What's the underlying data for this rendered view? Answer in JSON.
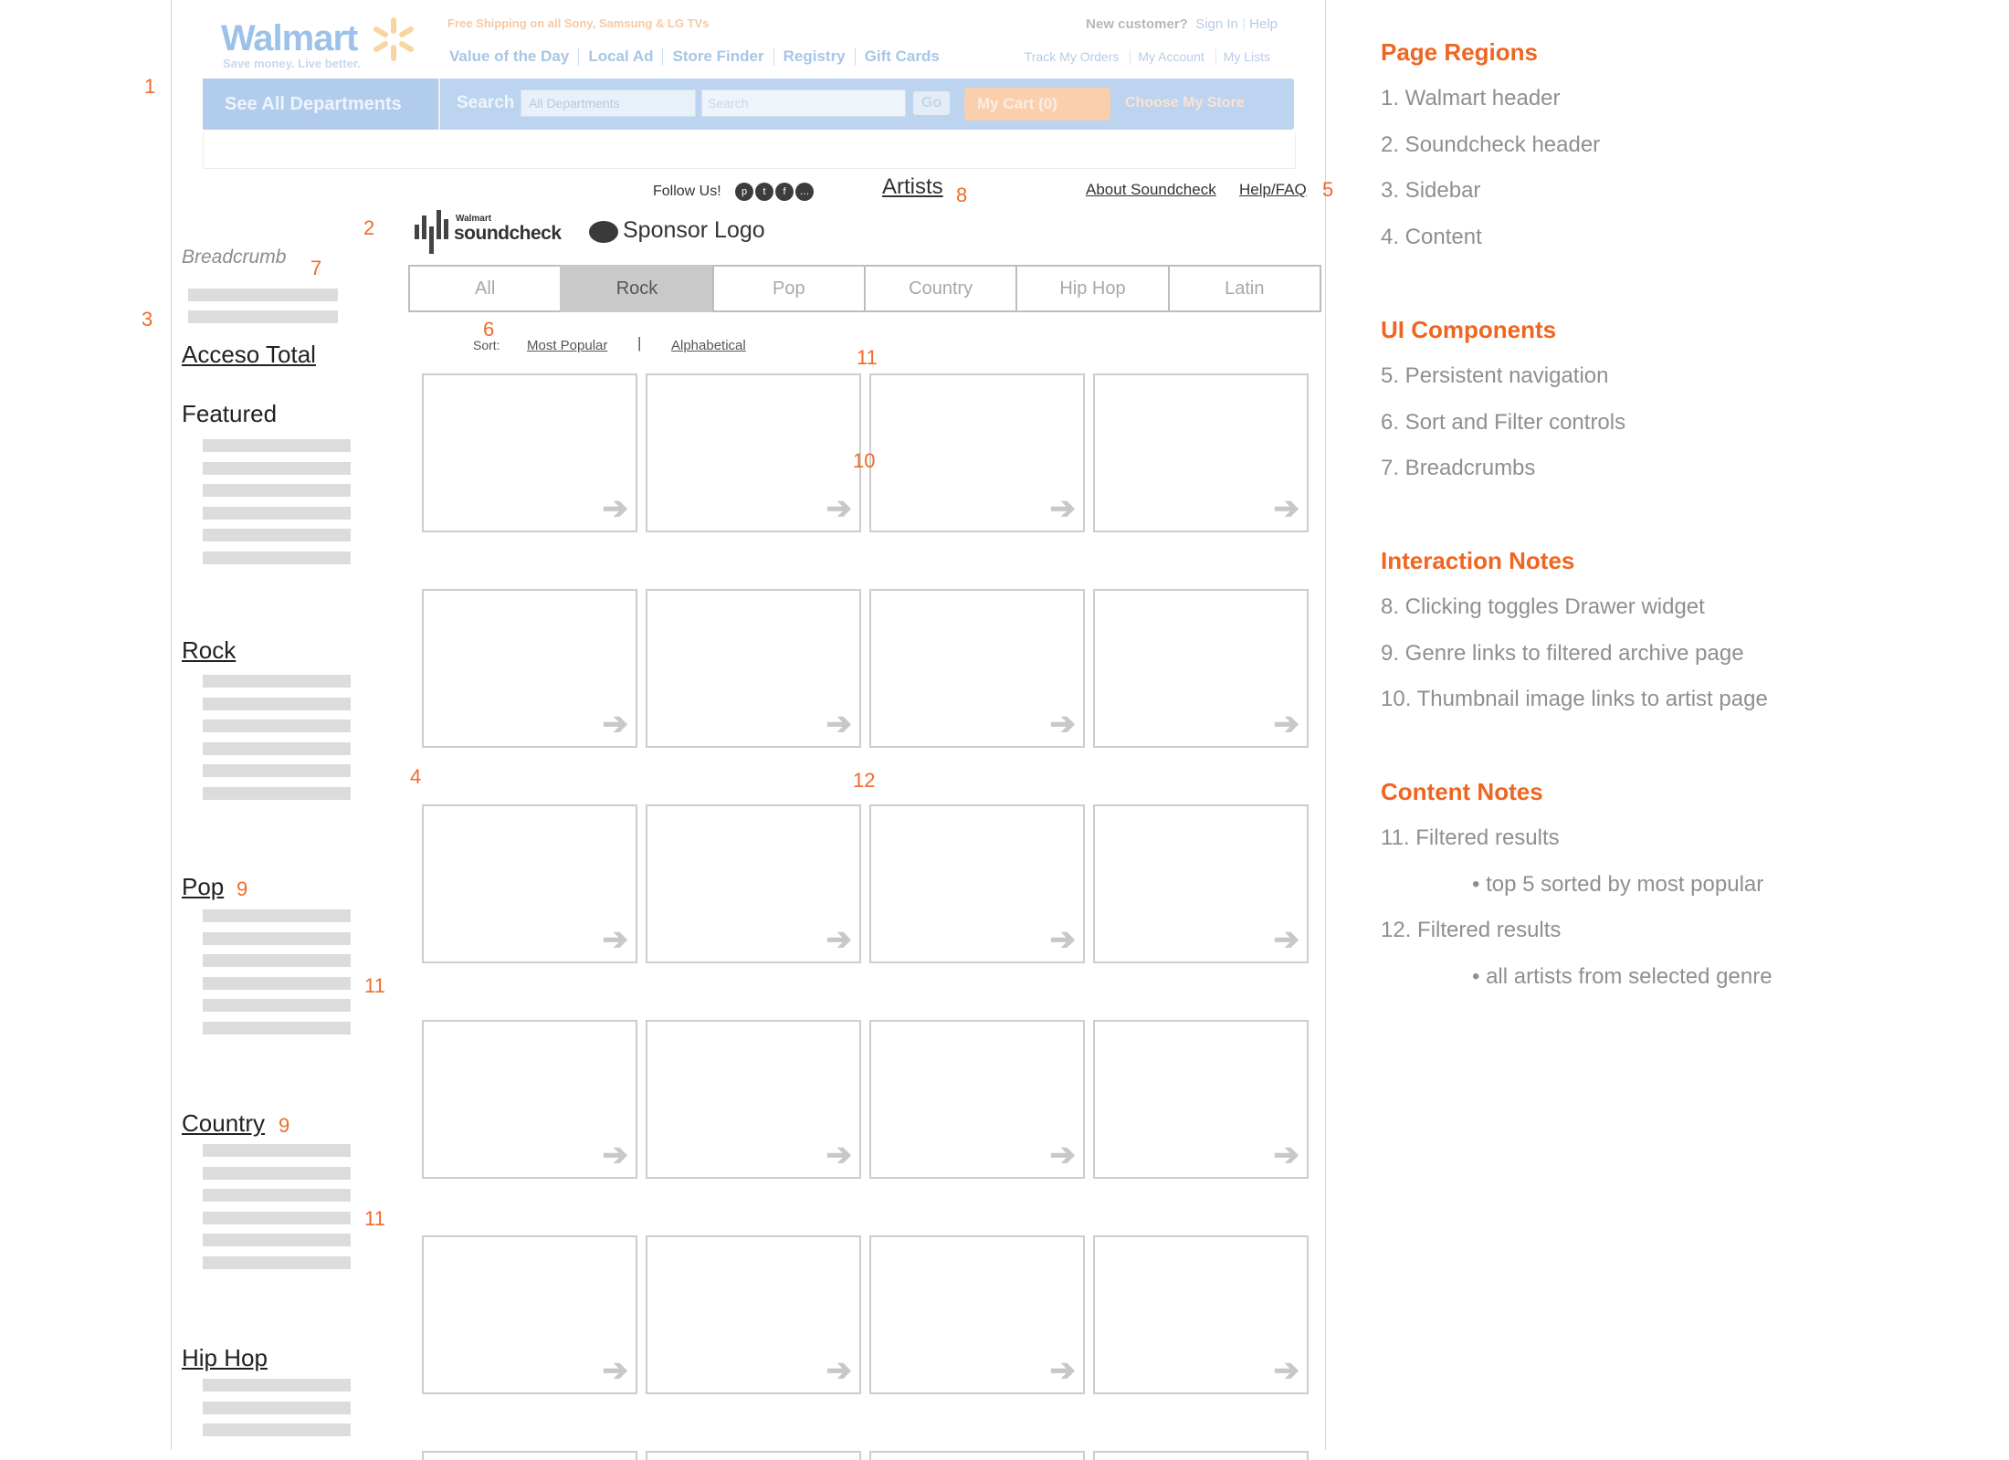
{
  "walmart": {
    "logo": "Walmart",
    "tagline": "Save money. Live better.",
    "promo": "Free Shipping on all Sony, Samsung & LG TVs",
    "new_customer": "New customer?",
    "sign_in": "Sign In",
    "help": "Help",
    "nav": [
      "Value of the Day",
      "Local Ad",
      "Store Finder",
      "Registry",
      "Gift Cards"
    ],
    "account_links": [
      "Track My Orders",
      "My Account",
      "My Lists"
    ],
    "departments_button": "See All Departments",
    "search_label": "Search",
    "search_select": "All Departments",
    "search_placeholder": "Search",
    "go_button": "Go",
    "cart": "My Cart (0)",
    "store": "Choose My Store"
  },
  "soundcheck": {
    "follow": "Follow Us!",
    "social_icons": [
      "pinterest-icon",
      "twitter-icon",
      "facebook-icon",
      "more-icon"
    ],
    "artists": "Artists",
    "about": "About Soundcheck",
    "help": "Help/FAQ",
    "logo_small": "Walmart",
    "logo_word": "soundcheck",
    "sponsor": "Sponsor Logo"
  },
  "tabs": [
    {
      "label": "All",
      "active": false
    },
    {
      "label": "Rock",
      "active": true
    },
    {
      "label": "Pop",
      "active": false
    },
    {
      "label": "Country",
      "active": false
    },
    {
      "label": "Hip Hop",
      "active": false
    },
    {
      "label": "Latin",
      "active": false
    }
  ],
  "sort": {
    "label": "Sort:",
    "most_popular": "Most Popular",
    "alphabetical": "Alphabetical",
    "separator": "|"
  },
  "sidebar": {
    "breadcrumb": "Breadcrumb",
    "acceso": "Acceso Total",
    "featured": "Featured",
    "rock": "Rock",
    "pop": "Pop",
    "country": "Country",
    "hiphop": "Hip Hop"
  },
  "annotations": {
    "a1": "1",
    "a2": "2",
    "a3": "3",
    "a4": "4",
    "a5": "5",
    "a6": "6",
    "a7": "7",
    "a8": "8",
    "a9a": "9",
    "a9b": "9",
    "a10": "10",
    "a11a": "11",
    "a11b": "11",
    "a11c": "11",
    "a12": "12"
  },
  "notes": {
    "page_regions_title": "Page Regions",
    "page_regions": [
      "1. Walmart header",
      "2. Soundcheck header",
      "3. Sidebar",
      "4. Content"
    ],
    "ui_title": "UI Components",
    "ui": [
      "5. Persistent navigation",
      "6. Sort and Filter controls",
      "7. Breadcrumbs"
    ],
    "interaction_title": "Interaction Notes",
    "interaction": [
      "8. Clicking toggles Drawer widget",
      "9. Genre links to filtered archive page",
      "10. Thumbnail image links to artist page"
    ],
    "content_title": "Content Notes",
    "content_11": "11. Filtered results",
    "content_11_sub": "• top 5 sorted by most popular",
    "content_12": "12. Filtered results",
    "content_12_sub": "• all artists from selected genre"
  },
  "colors": {
    "accent": "#f06a2a",
    "tab_active": "#c9c9c9",
    "walmart_blue": "#bcd4ef",
    "cart_orange": "#f9cfae"
  }
}
